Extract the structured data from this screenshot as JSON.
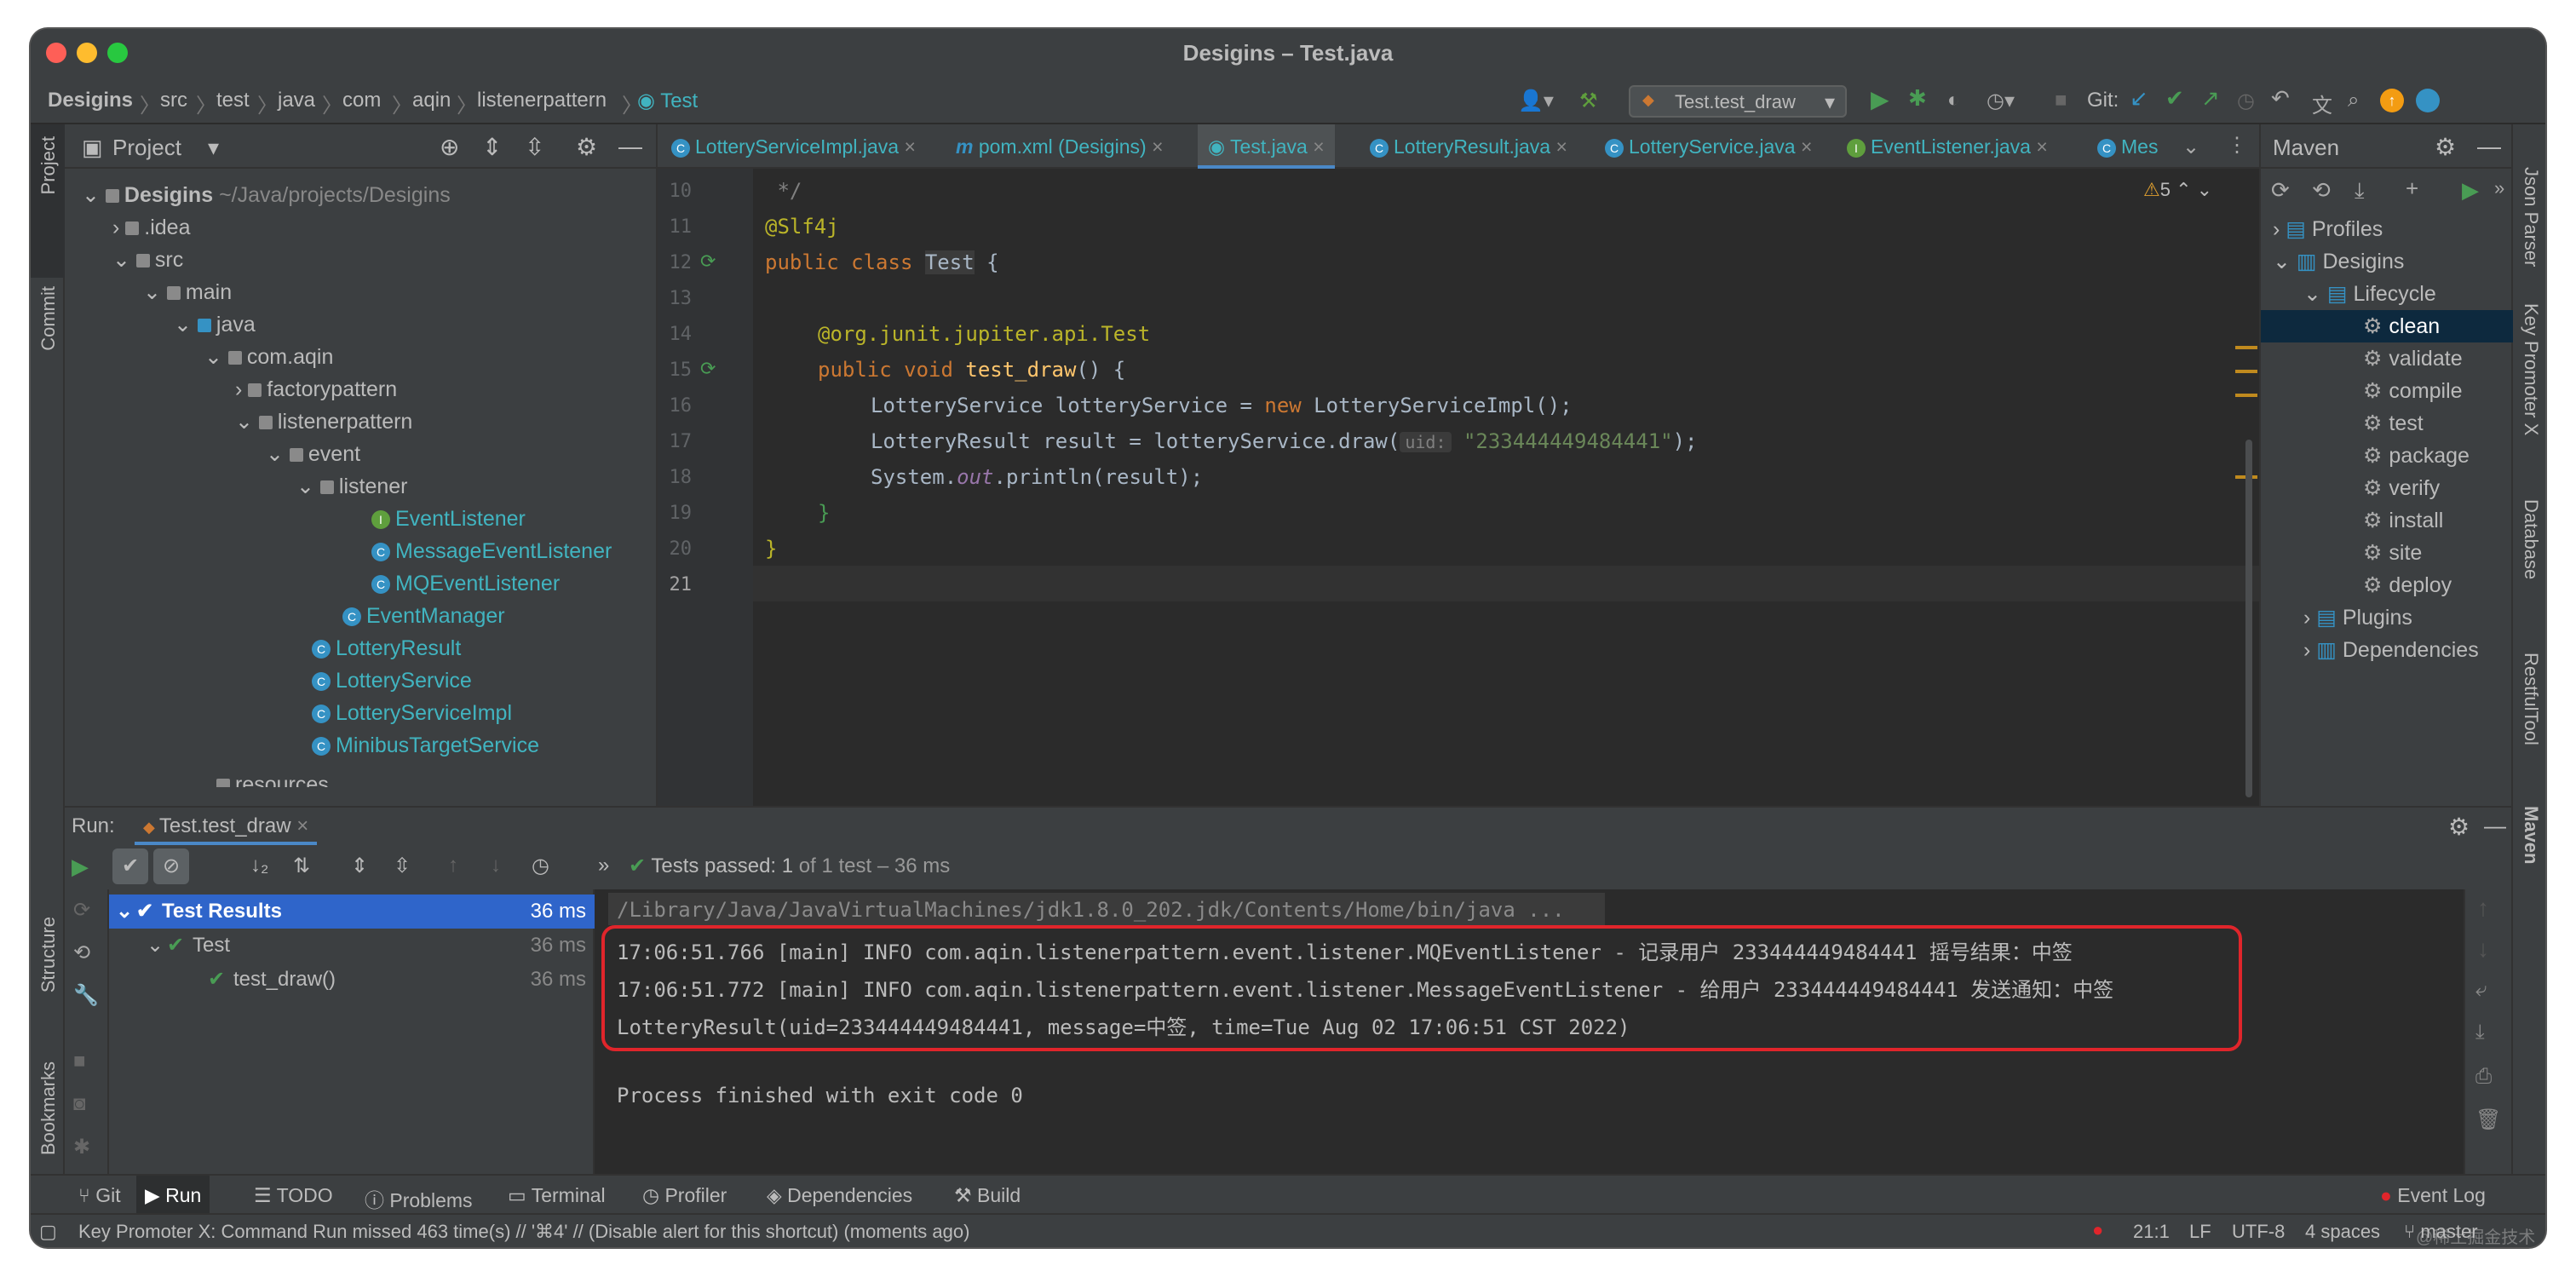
{
  "window": {
    "title": "Desigins – Test.java"
  },
  "breadcrumb": [
    "Desigins",
    "src",
    "test",
    "java",
    "com",
    "aqin",
    "listenerpattern",
    "Test"
  ],
  "toolbar": {
    "run_config": "Test.test_draw",
    "git_label": "Git:"
  },
  "left_strip": [
    "Project",
    "Commit",
    "Structure",
    "Bookmarks"
  ],
  "right_strip": [
    "Json Parser",
    "Key Promoter X",
    "Database",
    "RestfulTool",
    "Maven"
  ],
  "project": {
    "header": "Project",
    "root": "Desigins",
    "root_path": "~/Java/projects/Desigins",
    "items": [
      {
        "label": "Desigins",
        "depth": 0,
        "type": "folder"
      },
      {
        "label": ".idea",
        "depth": 1,
        "type": "folder"
      },
      {
        "label": "src",
        "depth": 1,
        "type": "folder"
      },
      {
        "label": "main",
        "depth": 2,
        "type": "folder"
      },
      {
        "label": "java",
        "depth": 3,
        "type": "folder"
      },
      {
        "label": "com.aqin",
        "depth": 4,
        "type": "folder"
      },
      {
        "label": "factorypattern",
        "depth": 5,
        "type": "folder"
      },
      {
        "label": "listenerpattern",
        "depth": 5,
        "type": "folder"
      },
      {
        "label": "event",
        "depth": 6,
        "type": "folder"
      },
      {
        "label": "listener",
        "depth": 7,
        "type": "folder"
      },
      {
        "label": "EventListener",
        "depth": 8,
        "type": "interface"
      },
      {
        "label": "MessageEventListener",
        "depth": 8,
        "type": "class"
      },
      {
        "label": "MQEventListener",
        "depth": 8,
        "type": "class"
      },
      {
        "label": "EventManager",
        "depth": 7,
        "type": "class"
      },
      {
        "label": "LotteryResult",
        "depth": 6,
        "type": "class"
      },
      {
        "label": "LotteryService",
        "depth": 6,
        "type": "class"
      },
      {
        "label": "LotteryServiceImpl",
        "depth": 6,
        "type": "class"
      },
      {
        "label": "MinibusTargetService",
        "depth": 6,
        "type": "class"
      },
      {
        "label": "resources",
        "depth": 3,
        "type": "folder"
      }
    ]
  },
  "editor": {
    "tabs": [
      "LotteryServiceImpl.java",
      "pom.xml (Desigins)",
      "Test.java",
      "LotteryResult.java",
      "LotteryService.java",
      "EventListener.java",
      "Mes"
    ],
    "active_tab": "Test.java",
    "warnings": "5",
    "line_numbers": [
      "10",
      "11",
      "12",
      "13",
      "14",
      "15",
      "16",
      "17",
      "18",
      "19",
      "20",
      "21"
    ],
    "lines": {
      "l10": " */",
      "l11": "@Slf4j",
      "l12_kw": "public class ",
      "l12_name": "Test",
      "l12_rest": " {",
      "l14_ann": "@org.junit.jupiter.api.",
      "l14_ann2": "Test",
      "l15_kw": "public void ",
      "l15_fn": "test_draw",
      "l15_rest": "() {",
      "l16_a": "LotteryService lotteryService = ",
      "l16_kw": "new ",
      "l16_b": "LotteryServiceImpl();",
      "l17_a": "LotteryResult result = lotteryService.draw(",
      "l17_hint": "uid:",
      "l17_str": "\"233444449484441\"",
      "l17_b": ");",
      "l18_a": "System.",
      "l18_it": "out",
      "l18_b": ".println(result);",
      "l19": "}",
      "l20": "}"
    }
  },
  "maven": {
    "header": "Maven",
    "items": [
      {
        "label": "Profiles",
        "depth": 0
      },
      {
        "label": "Desigins",
        "depth": 0
      },
      {
        "label": "Lifecycle",
        "depth": 1
      },
      {
        "label": "clean",
        "depth": 2
      },
      {
        "label": "validate",
        "depth": 2
      },
      {
        "label": "compile",
        "depth": 2
      },
      {
        "label": "test",
        "depth": 2
      },
      {
        "label": "package",
        "depth": 2
      },
      {
        "label": "verify",
        "depth": 2
      },
      {
        "label": "install",
        "depth": 2
      },
      {
        "label": "site",
        "depth": 2
      },
      {
        "label": "deploy",
        "depth": 2
      },
      {
        "label": "Plugins",
        "depth": 1
      },
      {
        "label": "Dependencies",
        "depth": 1
      }
    ],
    "selected": "clean"
  },
  "run": {
    "label": "Run:",
    "tab": "Test.test_draw",
    "status_bold": "Tests passed: 1",
    "status_rest": " of 1 test – 36 ms",
    "results": [
      {
        "label": "Test Results",
        "time": "36 ms",
        "depth": 0
      },
      {
        "label": "Test",
        "time": "36 ms",
        "depth": 1
      },
      {
        "label": "test_draw()",
        "time": "36 ms",
        "depth": 2
      }
    ],
    "console": {
      "cmd": "/Library/Java/JavaVirtualMachines/jdk1.8.0_202.jdk/Contents/Home/bin/java ...",
      "line1": "17:06:51.766 [main] INFO com.aqin.listenerpattern.event.listener.MQEventListener - 记录用户 233444449484441 摇号结果：中签",
      "line2": "17:06:51.772 [main] INFO com.aqin.listenerpattern.event.listener.MessageEventListener - 给用户 233444449484441 发送通知：中签",
      "line3": "LotteryResult(uid=233444449484441, message=中签, time=Tue Aug 02 17:06:51 CST 2022)",
      "exit": "Process finished with exit code 0"
    }
  },
  "bottom_tabs": [
    "Git",
    "Run",
    "TODO",
    "Problems",
    "Terminal",
    "Profiler",
    "Dependencies",
    "Build"
  ],
  "event_log": "Event Log",
  "status": {
    "message": "Key Promoter X: Command Run missed 463 time(s) // '⌘4' // (Disable alert for this shortcut) (moments ago)",
    "position": "21:1",
    "line_sep": "LF",
    "encoding": "UTF-8",
    "indent": "4 spaces",
    "branch": "master",
    "watermark": "@稀土掘金技术社区"
  }
}
